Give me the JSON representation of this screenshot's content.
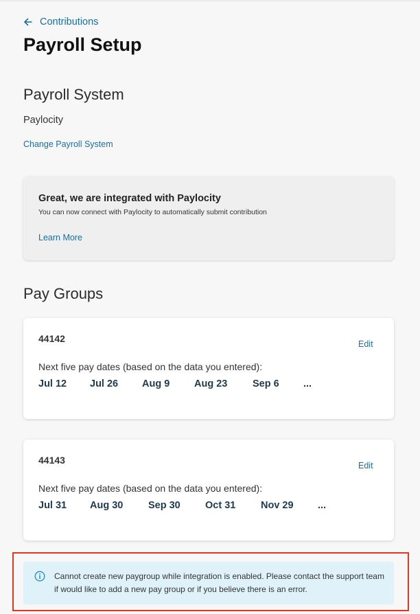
{
  "nav": {
    "back_label": "Contributions"
  },
  "page": {
    "title": "Payroll Setup"
  },
  "payroll_system": {
    "section_title": "Payroll System",
    "system_name": "Paylocity",
    "change_link": "Change Payroll System"
  },
  "integration": {
    "heading": "Great, we are integrated with Paylocity",
    "description": "You can now connect with Paylocity to automatically submit contribution",
    "learn_more": "Learn More"
  },
  "pay_groups": {
    "section_title": "Pay Groups",
    "groups": [
      {
        "id": "44142",
        "edit_label": "Edit",
        "dates_label": "Next five pay dates (based on the data you entered):",
        "dates": [
          "Jul 12",
          "Jul 26",
          "Aug 9",
          "Aug 23",
          "Sep 6",
          "..."
        ]
      },
      {
        "id": "44143",
        "edit_label": "Edit",
        "dates_label": "Next five pay dates (based on the data you entered):",
        "dates": [
          "Jul 31",
          "Aug 30",
          "Sep 30",
          "Oct 31",
          "Nov 29",
          "..."
        ]
      }
    ]
  },
  "alert": {
    "message": "Cannot create new paygroup while integration is enabled. Please contact the support team if would like to add a new pay group or if you believe there is an error."
  },
  "colors": {
    "link": "#1a6fa0",
    "alert_bg": "#dff2fa",
    "highlight_border": "#e8341c"
  }
}
